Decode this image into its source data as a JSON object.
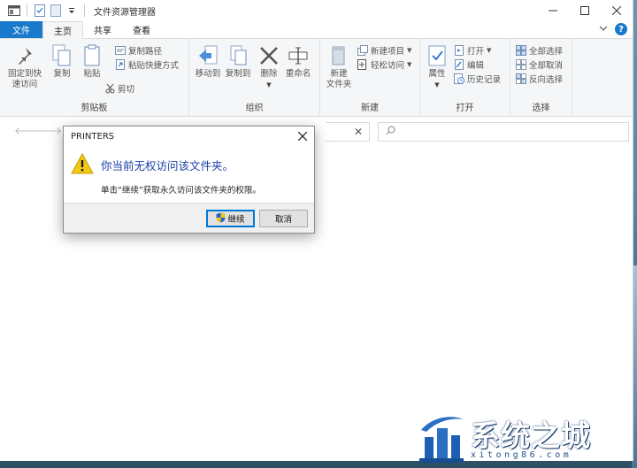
{
  "window": {
    "title": "文件资源管理器"
  },
  "tabs": {
    "file": "文件",
    "home": "主页",
    "share": "共享",
    "view": "查看"
  },
  "ribbon": {
    "clipboard": {
      "label": "剪贴板",
      "pin_line1": "固定到快",
      "pin_line2": "速访问",
      "copy": "复制",
      "paste": "粘贴",
      "copy_path": "复制路径",
      "paste_shortcut": "粘贴快捷方式",
      "cut": "剪切"
    },
    "organize": {
      "label": "组织",
      "move_to": "移动到",
      "copy_to": "复制到",
      "delete": "删除",
      "rename": "重命名"
    },
    "new": {
      "label": "新建",
      "new_folder_line1": "新建",
      "new_folder_line2": "文件夹",
      "new_item": "新建项目",
      "easy_access": "轻松访问"
    },
    "open": {
      "label": "打开",
      "properties": "属性",
      "open": "打开",
      "edit": "编辑",
      "history": "历史记录"
    },
    "select": {
      "label": "选择",
      "select_all": "全部选择",
      "select_none": "全部取消",
      "invert": "反向选择"
    }
  },
  "dialog": {
    "title": "PRINTERS",
    "main_text": "你当前无权访问该文件夹。",
    "sub_text": "单击“继续”获取永久访问该文件夹的权限。",
    "continue_label": "继续",
    "cancel_label": "取消"
  },
  "watermark": {
    "text": "系统之城",
    "url": "xitong86.com"
  },
  "colors": {
    "accent": "#1979ca",
    "dialog_text": "#1a3fa6",
    "warning": "#f2c811"
  }
}
